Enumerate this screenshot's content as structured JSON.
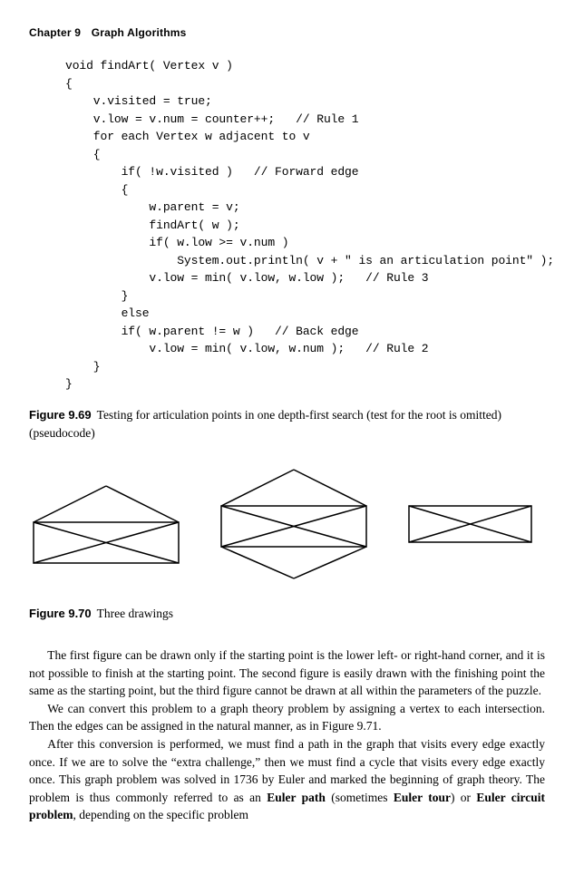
{
  "chapter": {
    "label": "Chapter 9",
    "title": "Graph Algorithms"
  },
  "code": {
    "l1": "void findArt( Vertex v )",
    "l2": "{",
    "l3": "    v.visited = true;",
    "l4": "    v.low = v.num = counter++;   // Rule 1",
    "l5": "    for each Vertex w adjacent to v",
    "l6": "    {",
    "l7": "        if( !w.visited )   // Forward edge",
    "l8": "        {",
    "l9": "            w.parent = v;",
    "l10": "            findArt( w );",
    "l11": "            if( w.low >= v.num )",
    "l12": "                System.out.println( v + \" is an articulation point\" );",
    "l13": "            v.low = min( v.low, w.low );   // Rule 3",
    "l14": "        }",
    "l15": "        else",
    "l16": "        if( w.parent != w )   // Back edge",
    "l17": "            v.low = min( v.low, w.num );   // Rule 2",
    "l18": "    }",
    "l19": "}"
  },
  "fig69": {
    "label": "Figure 9.69",
    "caption": "Testing for articulation points in one depth-first search (test for the root is omitted) (pseudocode)"
  },
  "fig70": {
    "label": "Figure 9.70",
    "caption": "Three drawings"
  },
  "paragraphs": {
    "p1": "The first figure can be drawn only if the starting point is the lower left- or right-hand corner, and it is not possible to finish at the starting point. The second figure is easily drawn with the finishing point the same as the starting point, but the third figure cannot be drawn at all within the parameters of the puzzle.",
    "p2": "We can convert this problem to a graph theory problem by assigning a vertex to each intersection. Then the edges can be assigned in the natural manner, as in Figure 9.71.",
    "p3a": "After this conversion is performed, we must find a path in the graph that visits every edge exactly once. If we are to solve the “extra challenge,” then we must find a cycle that visits every edge exactly once. This graph problem was solved in 1736 by Euler and marked the beginning of graph theory. The problem is thus commonly referred to as an ",
    "p3term1": "Euler path",
    "p3b": " (sometimes ",
    "p3term2": "Euler tour",
    "p3c": ") or ",
    "p3term3": "Euler circuit problem",
    "p3d": ", depending on the specific problem"
  }
}
